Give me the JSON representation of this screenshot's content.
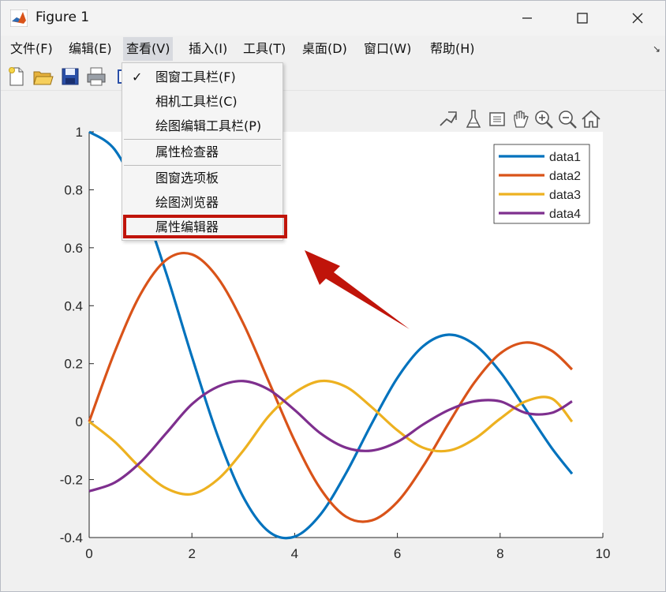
{
  "window": {
    "title": "Figure 1",
    "icon": "matlab-logo-icon",
    "controls": [
      "minimize-icon",
      "maximize-icon",
      "close-icon"
    ]
  },
  "menubar": {
    "items": [
      {
        "label": "文件(F)"
      },
      {
        "label": "编辑(E)"
      },
      {
        "label": "查看(V)",
        "active": true
      },
      {
        "label": "插入(I)"
      },
      {
        "label": "工具(T)"
      },
      {
        "label": "桌面(D)"
      },
      {
        "label": "窗口(W)"
      },
      {
        "label": "帮助(H)"
      }
    ],
    "corner_icon": "dock-arrow-icon",
    "corner_glyph": "↘"
  },
  "toolbar": {
    "buttons": [
      "new-figure-icon",
      "open-file-icon",
      "save-icon",
      "print-icon"
    ]
  },
  "view_menu": {
    "items": [
      {
        "label": "图窗工具栏(F)",
        "checked": true
      },
      {
        "label": "相机工具栏(C)",
        "checked": false
      },
      {
        "label": "绘图编辑工具栏(P)",
        "checked": false
      },
      {
        "label": "属性检查器",
        "checked": false
      },
      {
        "label": "图窗选项板",
        "checked": false
      },
      {
        "label": "绘图浏览器",
        "checked": false
      },
      {
        "label": "属性编辑器",
        "checked": false,
        "highlighted": true
      }
    ],
    "check_glyph": "✓"
  },
  "axes_toolbar": {
    "buttons": [
      "brush-export-icon",
      "data-tips-icon",
      "brush-icon",
      "pan-hand-icon",
      "zoom-in-icon",
      "zoom-out-icon",
      "home-icon"
    ]
  },
  "annotation": {
    "arrow_color": "#c0140a",
    "highlight_color": "#c0140a"
  },
  "chart_data": {
    "type": "line",
    "x": [
      0,
      0.5,
      1.0,
      1.5,
      2.0,
      2.5,
      3.0,
      3.5,
      4.0,
      4.5,
      5.0,
      5.5,
      6.0,
      6.5,
      7.0,
      7.5,
      8.0,
      8.5,
      9.0,
      9.4
    ],
    "series": [
      {
        "name": "data1",
        "color": "#0072BD",
        "values": [
          1.0,
          0.938,
          0.765,
          0.512,
          0.224,
          -0.048,
          -0.26,
          -0.38,
          -0.397,
          -0.321,
          -0.178,
          -0.007,
          0.151,
          0.26,
          0.3,
          0.266,
          0.172,
          0.042,
          -0.09,
          -0.18
        ]
      },
      {
        "name": "data2",
        "color": "#D95319",
        "values": [
          0.0,
          0.242,
          0.44,
          0.558,
          0.577,
          0.497,
          0.339,
          0.137,
          -0.066,
          -0.231,
          -0.328,
          -0.341,
          -0.277,
          -0.154,
          -0.005,
          0.135,
          0.235,
          0.273,
          0.245,
          0.18
        ]
      },
      {
        "name": "data3",
        "color": "#EDB120",
        "values": [
          0.0,
          -0.07,
          -0.16,
          -0.23,
          -0.25,
          -0.2,
          -0.1,
          0.02,
          0.1,
          0.14,
          0.12,
          0.05,
          -0.03,
          -0.09,
          -0.1,
          -0.06,
          0.01,
          0.07,
          0.08,
          0.0
        ]
      },
      {
        "name": "data4",
        "color": "#7E2F8E",
        "values": [
          -0.24,
          -0.21,
          -0.14,
          -0.04,
          0.06,
          0.12,
          0.14,
          0.11,
          0.04,
          -0.04,
          -0.09,
          -0.1,
          -0.07,
          -0.01,
          0.04,
          0.07,
          0.07,
          0.03,
          0.03,
          0.07
        ]
      }
    ],
    "xlim": [
      0,
      10
    ],
    "ylim": [
      -0.4,
      1
    ],
    "xticks": [
      0,
      2,
      4,
      6,
      8,
      10
    ],
    "yticks": [
      -0.4,
      -0.2,
      0,
      0.2,
      0.4,
      0.6,
      0.8,
      1
    ],
    "xtick_labels": [
      "0",
      "2",
      "4",
      "6",
      "8",
      "10"
    ],
    "ytick_labels": [
      "-0.4",
      "-0.2",
      "0",
      "0.2",
      "0.4",
      "0.6",
      "0.8",
      "1"
    ],
    "legend_position": "top-right",
    "grid": false
  }
}
